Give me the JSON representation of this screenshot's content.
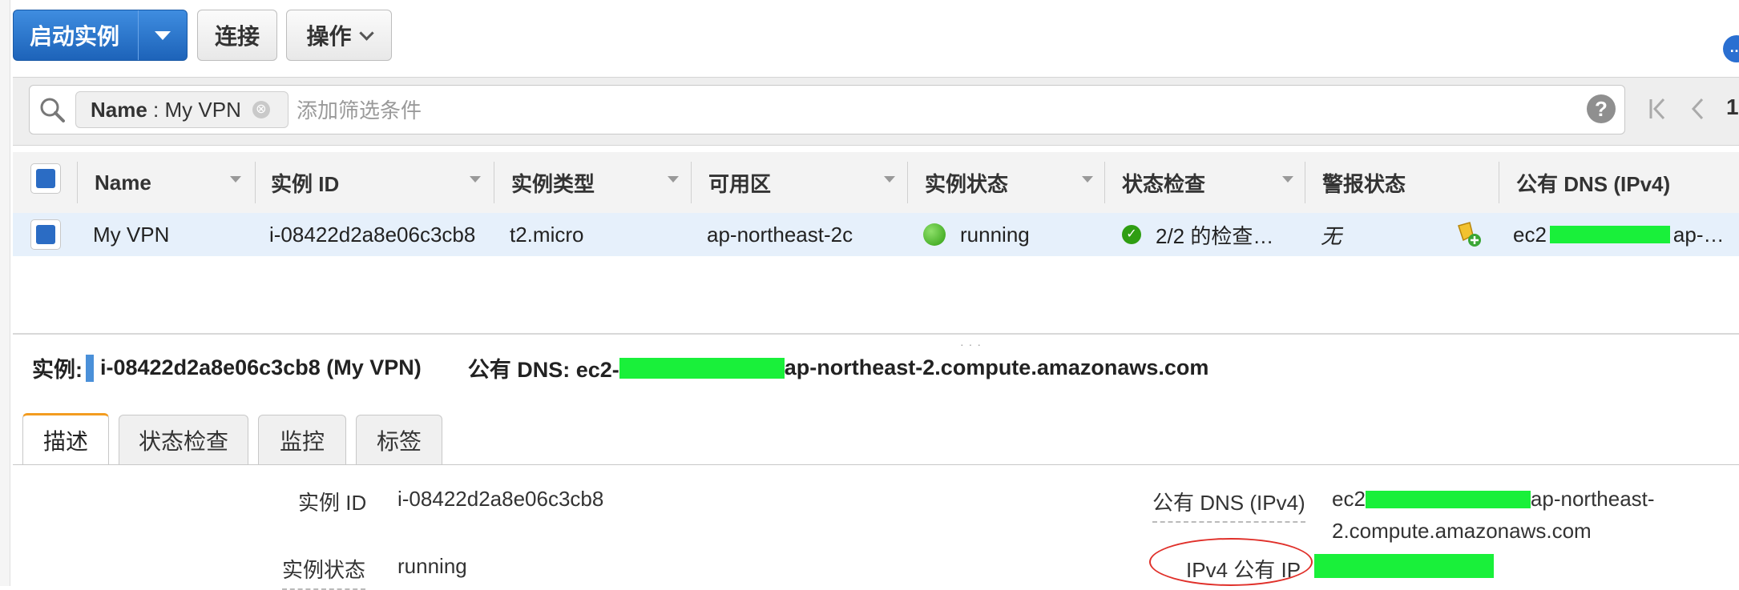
{
  "toolbar": {
    "launch_label": "启动实例",
    "connect_label": "连接",
    "actions_label": "操作"
  },
  "filter": {
    "chip_key": "Name",
    "chip_sep": " : ",
    "chip_value": "My VPN",
    "chip_close": "⊗",
    "placeholder": "添加筛选条件",
    "help": "?",
    "page": "1"
  },
  "table": {
    "columns": [
      "Name",
      "实例 ID",
      "实例类型",
      "可用区",
      "实例状态",
      "状态检查",
      "警报状态",
      "公有 DNS (IPv4)"
    ],
    "row": {
      "name": "My VPN",
      "instance_id": "i-08422d2a8e06c3cb8",
      "type": "t2.micro",
      "az": "ap-northeast-2c",
      "state": "running",
      "checks": "2/2 的检查…",
      "alarm": "无",
      "dns_prefix": "ec2",
      "dns_suffix": "ap-…"
    }
  },
  "detail": {
    "instance_label": "实例:",
    "instance_value": "i-08422d2a8e06c3cb8 (My VPN)",
    "dns_label": "公有 DNS: ec2-",
    "dns_suffix": "ap-northeast-2.compute.amazonaws.com",
    "tabs": [
      "描述",
      "状态检查",
      "监控",
      "标签"
    ],
    "fields": {
      "instance_id_label": "实例 ID",
      "instance_id_value": "i-08422d2a8e06c3cb8",
      "instance_state_label": "实例状态",
      "instance_state_value": "running",
      "public_dns_label": "公有 DNS (IPv4)",
      "public_dns_prefix": "ec2",
      "public_dns_suffix": "ap-northeast-",
      "public_dns_line2": "2.compute.amazonaws.com",
      "ipv4_label": "IPv4 公有 IP"
    }
  },
  "colors": {
    "primary": "#1d63b9",
    "redaction": "#19f03a",
    "active_tab": "#f39c1f",
    "annotation": "#e0302a"
  }
}
